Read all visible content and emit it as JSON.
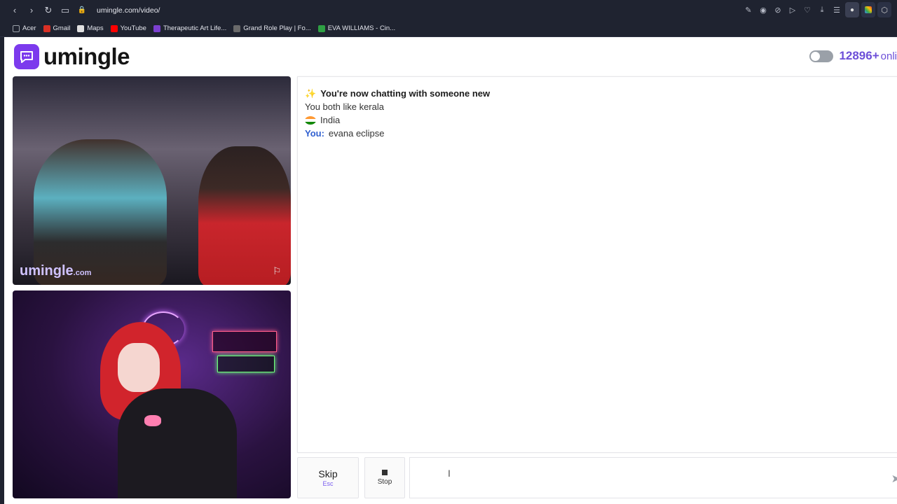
{
  "browser": {
    "url": "umingle.com/video/",
    "bookmarks": [
      {
        "label": "Acer",
        "color": "#9aa0a8"
      },
      {
        "label": "Gmail",
        "color": "#d93025"
      },
      {
        "label": "Maps",
        "color": "#e0e0e0"
      },
      {
        "label": "YouTube",
        "color": "#ff0000"
      },
      {
        "label": "Therapeutic Art Life...",
        "color": "#7b3fd0"
      },
      {
        "label": "Grand Role Play | Fo...",
        "color": "#6a6a6a"
      },
      {
        "label": "EVA WILLIAMS - Cin...",
        "color": "#2ea043"
      }
    ]
  },
  "header": {
    "brand": "umingle",
    "online_count": "12896+",
    "online_word": "onli"
  },
  "video": {
    "watermark": "umingle",
    "watermark_suffix": ".com"
  },
  "chat": {
    "lines": [
      {
        "icon": "✨",
        "text": "You're now chatting with someone new"
      },
      {
        "text": "You both like kerala"
      },
      {
        "flag": "🇮🇳",
        "text": "India"
      },
      {
        "speaker": "You:",
        "text": "evana eclipse"
      }
    ]
  },
  "controls": {
    "skip_label": "Skip",
    "skip_key": "Esc",
    "stop_label": "Stop"
  },
  "colors": {
    "brand_purple": "#7c3aed",
    "online_purple": "#6d4fd8",
    "you_blue": "#2f5fd0"
  }
}
